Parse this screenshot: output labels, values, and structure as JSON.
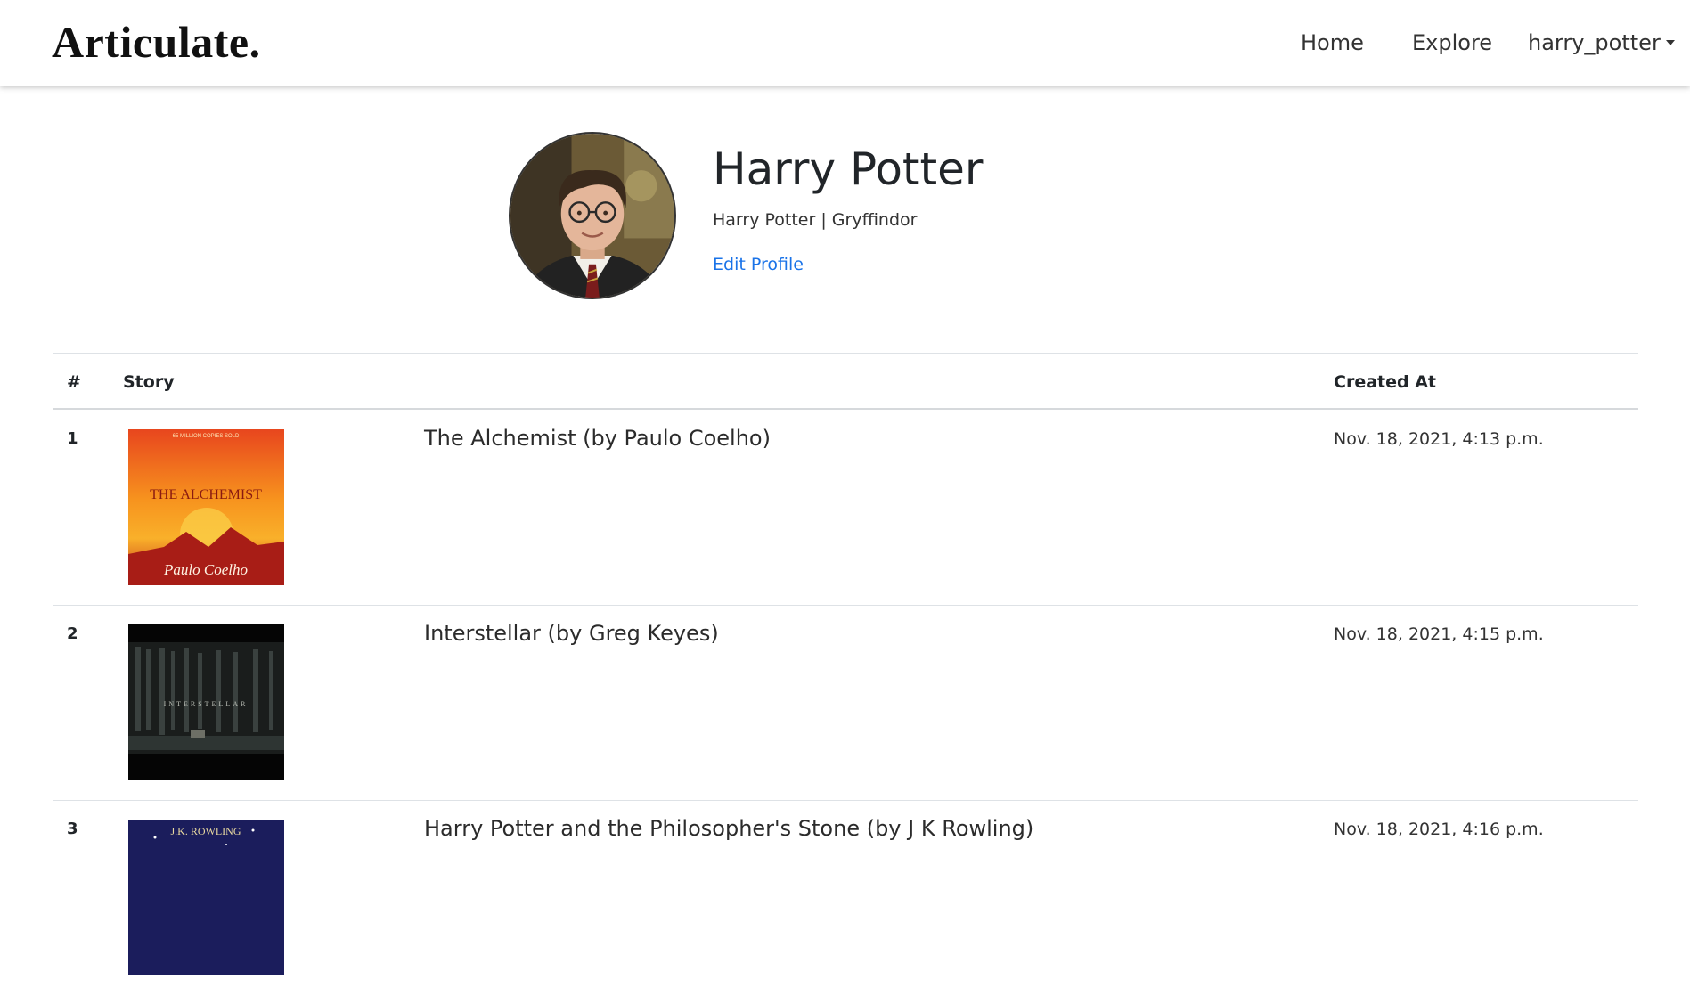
{
  "navbar": {
    "brand": "Articulate.",
    "links": {
      "home": "Home",
      "explore": "Explore"
    },
    "user_menu": "harry_potter"
  },
  "profile": {
    "name": "Harry Potter",
    "bio": "Harry Potter | Gryffindor",
    "edit_link": "Edit Profile"
  },
  "table": {
    "headers": {
      "num": "#",
      "story": "Story",
      "created": "Created At"
    },
    "rows": [
      {
        "num": "1",
        "title": "The Alchemist (by Paulo Coelho)",
        "created": "Nov. 18, 2021, 4:13 p.m.",
        "cover": {
          "text_top": "65 MILLION COPIES SOLD",
          "title": "THE ALCHEMIST",
          "author": "Paulo Coelho"
        }
      },
      {
        "num": "2",
        "title": "Interstellar (by Greg Keyes)",
        "created": "Nov. 18, 2021, 4:15 p.m.",
        "cover": {
          "title": "INTERSTELLAR"
        }
      },
      {
        "num": "3",
        "title": "Harry Potter and the Philosopher's Stone (by J K Rowling)",
        "created": "Nov. 18, 2021, 4:16 p.m.",
        "cover": {
          "author": "J.K. ROWLING"
        }
      }
    ]
  }
}
